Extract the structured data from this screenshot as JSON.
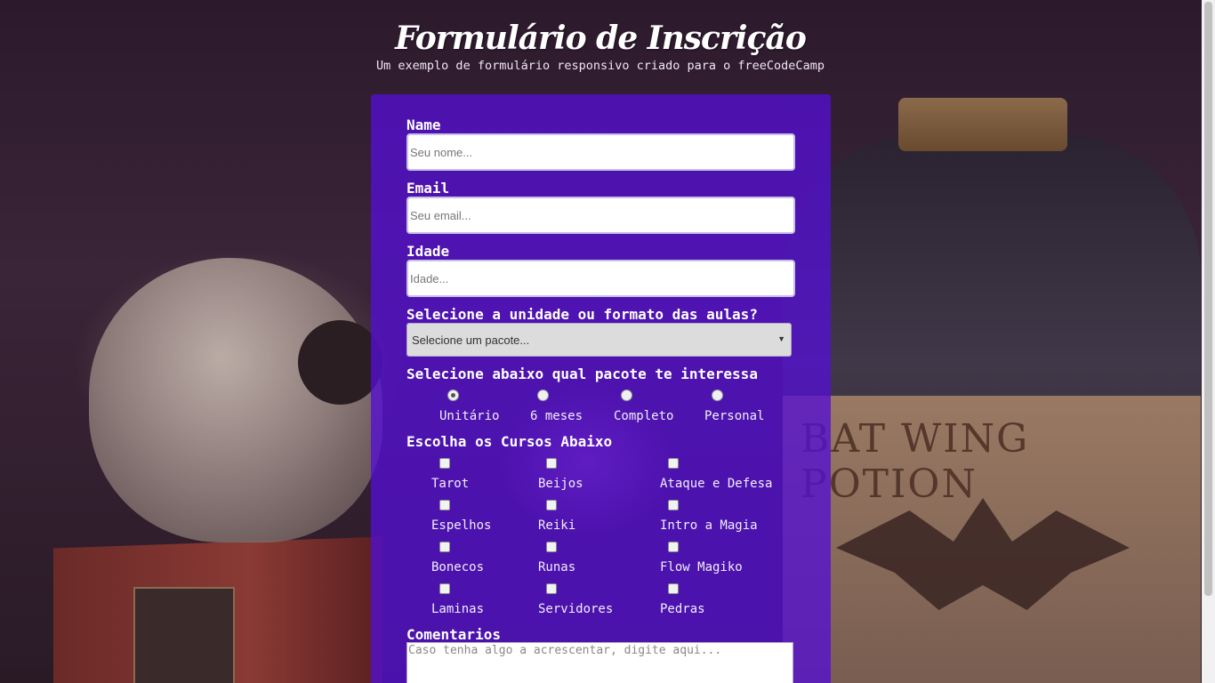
{
  "header": {
    "title": "Formulário de Inscrição",
    "subtitle": "Um exemplo de formulário responsivo criado para o freeCodeCamp"
  },
  "form": {
    "name": {
      "label": "Name",
      "placeholder": "Seu nome..."
    },
    "email": {
      "label": "Email",
      "placeholder": "Seu email..."
    },
    "age": {
      "label": "Idade",
      "placeholder": "Idade..."
    },
    "unit": {
      "label": "Selecione a unidade ou formato das aulas?",
      "selected": "Selecione um pacote..."
    },
    "package": {
      "label": "Selecione abaixo qual pacote te interessa",
      "options": [
        "Unitário",
        "6 meses",
        "Completo",
        "Personal"
      ],
      "selected_index": 0
    },
    "courses": {
      "label": "Escolha os Cursos Abaixo",
      "items": [
        "Tarot",
        "Beijos",
        "Ataque e Defesa",
        "Espelhos",
        "Reiki",
        "Intro a Magia",
        "Bonecos",
        "Runas",
        "Flow Magiko",
        "Laminas",
        "Servidores",
        "Pedras"
      ]
    },
    "comments": {
      "label": "Comentarios",
      "placeholder": "Caso tenha algo a acrescentar, digite aqui..."
    }
  },
  "background": {
    "label_text": "BAT WING POTION"
  },
  "colors": {
    "panel": "#5410d2",
    "text": "#ffffff"
  }
}
